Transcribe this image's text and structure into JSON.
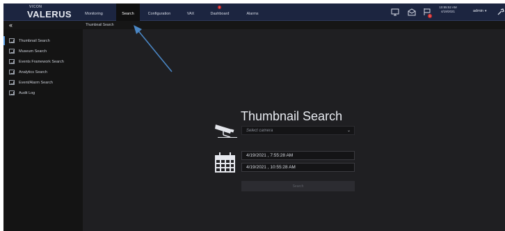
{
  "brand": {
    "small": "VICON",
    "name": "VALERUS"
  },
  "nav": {
    "items": [
      {
        "label": "Monitoring"
      },
      {
        "label": "Search"
      },
      {
        "label": "Configuration"
      },
      {
        "label": "VAX"
      },
      {
        "label": "Dashboard",
        "alert": "!"
      },
      {
        "label": "Alarms"
      }
    ],
    "active": "Search"
  },
  "header_right": {
    "icons": [
      "monitor-icon",
      "mail-icon",
      "flag-icon"
    ],
    "flag_badge": "1",
    "clock_time": "10:55:52 AM",
    "clock_date": "4/19/2021",
    "user": "admin",
    "user_caret": "▾"
  },
  "subheader": {
    "collapse": "«",
    "title": "Thumbnail Search"
  },
  "sidebar": {
    "items": [
      {
        "label": "Thumbnail Search",
        "active": true
      },
      {
        "label": "Museum Search"
      },
      {
        "label": "Events Framework Search"
      },
      {
        "label": "Analytics Search"
      },
      {
        "label": "Event/Alarm Search"
      },
      {
        "label": "Audit Log"
      }
    ]
  },
  "panel": {
    "title": "Thumbnail Search",
    "camera_placeholder": "Select camera",
    "start": "4/19/2021 , 7:55:28 AM",
    "end": "4/19/2021 , 10:55:28 AM",
    "search_label": "Search"
  },
  "colors": {
    "accent": "#5aa0e6",
    "topbar": "#1c2540",
    "badge": "#d43030",
    "annotation_arrow": "#4a86c4"
  }
}
